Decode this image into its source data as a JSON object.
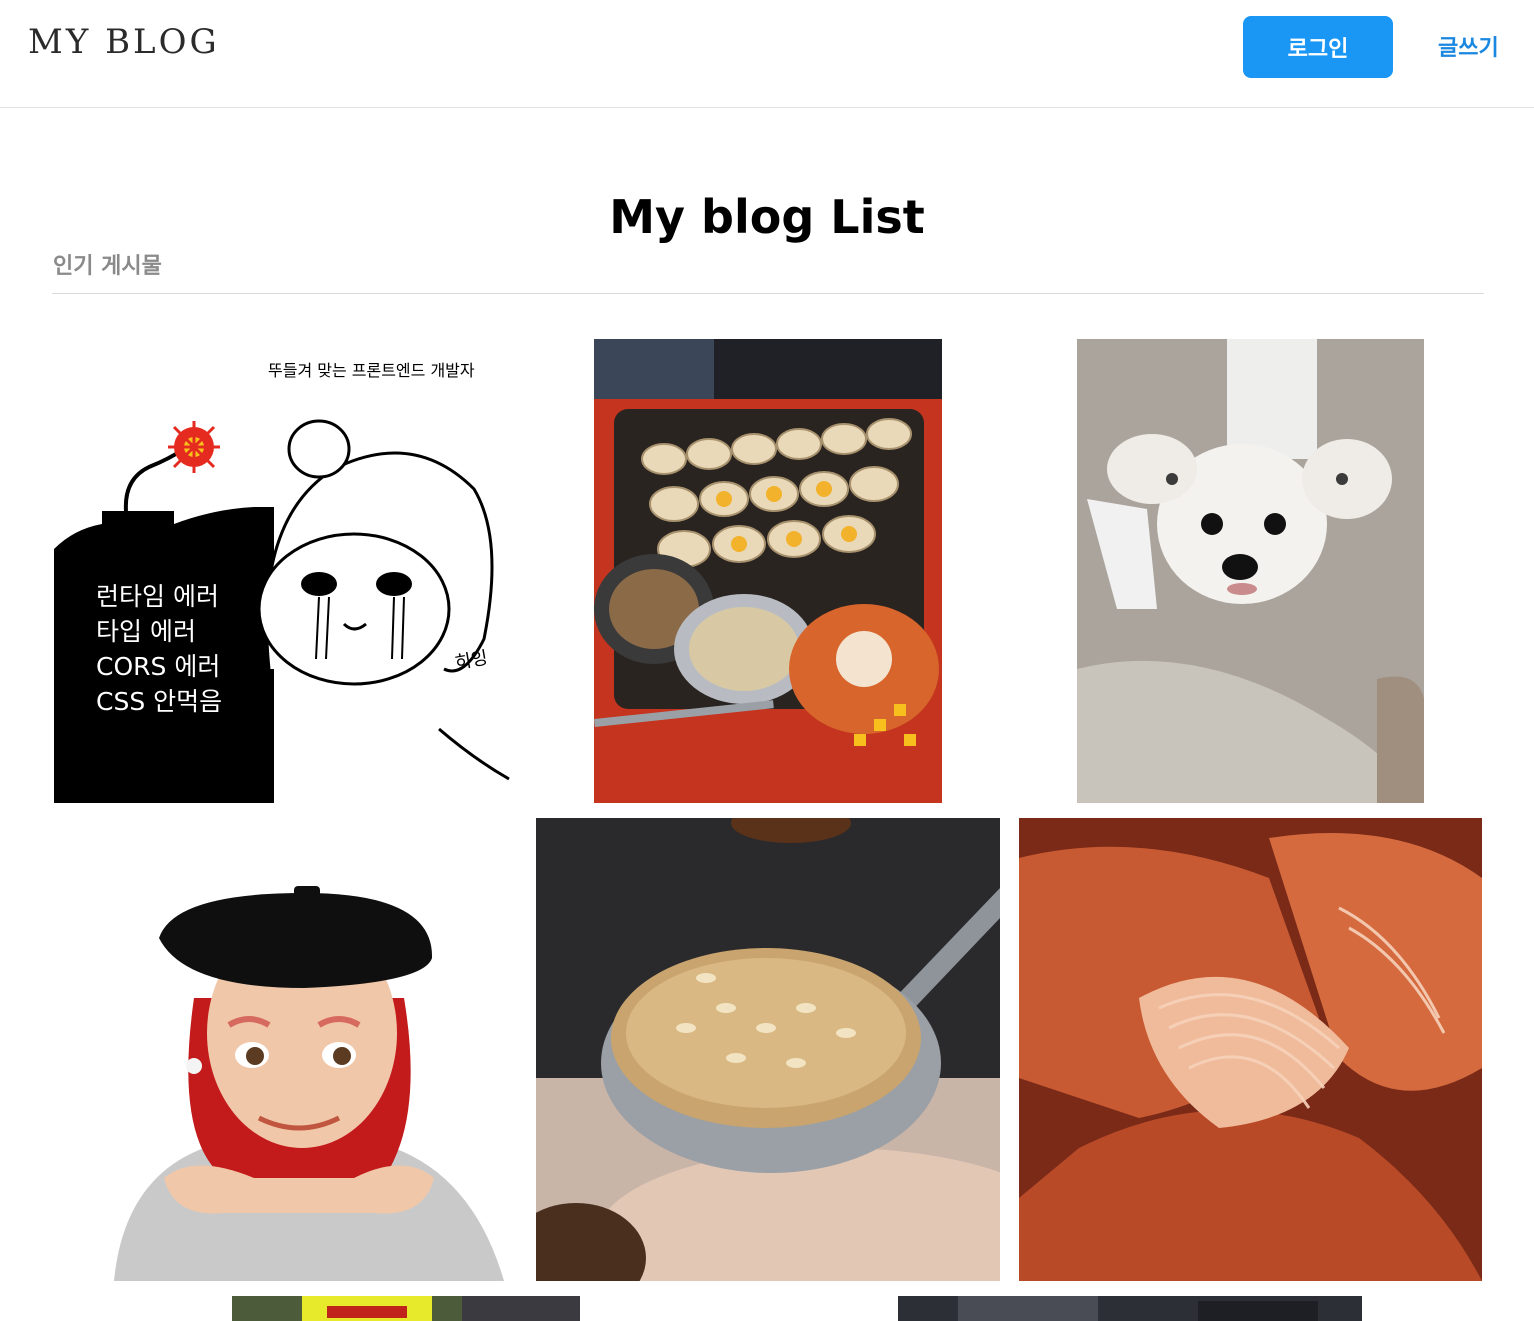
{
  "header": {
    "logo": "MY BLOG",
    "login_label": "로그인",
    "write_label": "글쓰기",
    "accent_color": "#1a96f5"
  },
  "main": {
    "title": "My blog List",
    "section_label": "인기 게시물",
    "posts": [
      {
        "type": "cartoon",
        "caption": "뚜들겨 맞는 프론트엔드 개발자",
        "bomb_lines": [
          "런타임 에러",
          "타입 에러",
          "CORS 에러",
          "CSS 안먹음"
        ],
        "sfx": "히잉"
      },
      {
        "type": "photo",
        "subject": "grilled-scallops"
      },
      {
        "type": "photo",
        "subject": "white-dog"
      },
      {
        "type": "avatar",
        "subject": "memoji-beret"
      },
      {
        "type": "photo",
        "subject": "rice-spoon"
      },
      {
        "type": "photo",
        "subject": "shredded-chicken"
      },
      {
        "type": "photo",
        "subject": "sign-photo"
      },
      {
        "type": "photo",
        "subject": "dark-photo"
      }
    ]
  }
}
